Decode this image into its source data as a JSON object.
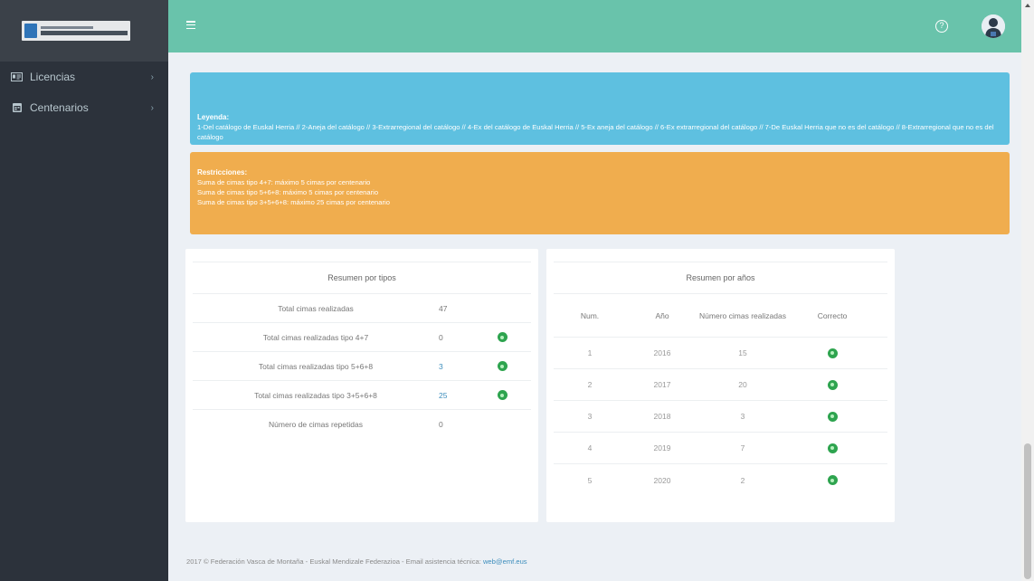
{
  "sidebar": {
    "items": [
      {
        "label": "Licencias",
        "icon": "id-card-icon"
      },
      {
        "label": "Centenarios",
        "icon": "calendar-icon"
      }
    ]
  },
  "header": {
    "menu_icon": "hamburger-icon",
    "help_icon": "help-circle-icon",
    "avatar": "user-avatar"
  },
  "legend": {
    "title": "Leyenda:",
    "text": "1-Del catálogo de Euskal Herria // 2-Aneja del catálogo // 3-Extrarregional del catálogo // 4-Ex del catálogo de Euskal Herria // 5-Ex aneja del catálogo // 6-Ex extrarregional del catálogo // 7-De Euskal Herria que no es del catálogo // 8-Extrarregional que no es del catálogo"
  },
  "restrictions": {
    "title": "Restricciones:",
    "lines": [
      "Suma de cimas tipo 4+7: máximo 5 cimas por centenario",
      "Suma de cimas tipo 5+6+8: máximo 5 cimas por centenario",
      "Suma de cimas tipo 3+5+6+8: máximo 25 cimas por centenario"
    ]
  },
  "tipos": {
    "title": "Resumen por tipos",
    "rows": [
      {
        "label": "Total cimas realizadas",
        "value": "47",
        "ok": false,
        "highlight": false
      },
      {
        "label": "Total cimas realizadas tipo 4+7",
        "value": "0",
        "ok": true,
        "highlight": false
      },
      {
        "label": "Total cimas realizadas tipo 5+6+8",
        "value": "3",
        "ok": true,
        "highlight": true
      },
      {
        "label": "Total cimas realizadas tipo 3+5+6+8",
        "value": "25",
        "ok": true,
        "highlight": true
      },
      {
        "label": "Número de cimas repetidas",
        "value": "0",
        "ok": false,
        "highlight": false
      }
    ]
  },
  "years": {
    "title": "Resumen por años",
    "headers": {
      "num": "Num.",
      "year": "Año",
      "count": "Número cimas realizadas",
      "ok": "Correcto"
    },
    "rows": [
      {
        "num": "1",
        "year": "2016",
        "count": "15",
        "ok": true
      },
      {
        "num": "2",
        "year": "2017",
        "count": "20",
        "ok": true
      },
      {
        "num": "3",
        "year": "2018",
        "count": "3",
        "ok": true
      },
      {
        "num": "4",
        "year": "2019",
        "count": "7",
        "ok": true
      },
      {
        "num": "5",
        "year": "2020",
        "count": "2",
        "ok": true
      }
    ]
  },
  "footer": {
    "text": "2017 © Federación Vasca de Montaña - Euskal Mendizale Federazioa - Email asistencia técnica:",
    "email": "web@emf.eus"
  },
  "colors": {
    "topbar": "#69c3ab",
    "sidebar": "#2c323b",
    "info": "#5ec0e0",
    "warning": "#f0ad4e",
    "success": "#2ea44f",
    "link": "#3c8dbc"
  }
}
